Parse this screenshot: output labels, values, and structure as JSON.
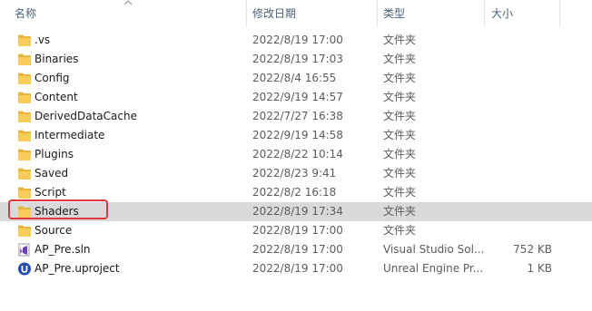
{
  "columns": {
    "name": "名称",
    "date": "修改日期",
    "type": "类型",
    "size": "大小"
  },
  "files": [
    {
      "icon": "folder-icon",
      "name": ".vs",
      "date": "2022/8/19 17:00",
      "type": "文件夹",
      "size": ""
    },
    {
      "icon": "folder-icon",
      "name": "Binaries",
      "date": "2022/8/19 17:03",
      "type": "文件夹",
      "size": ""
    },
    {
      "icon": "folder-icon",
      "name": "Config",
      "date": "2022/8/4 16:55",
      "type": "文件夹",
      "size": ""
    },
    {
      "icon": "folder-icon",
      "name": "Content",
      "date": "2022/9/19 14:57",
      "type": "文件夹",
      "size": ""
    },
    {
      "icon": "folder-icon",
      "name": "DerivedDataCache",
      "date": "2022/7/27 16:38",
      "type": "文件夹",
      "size": ""
    },
    {
      "icon": "folder-icon",
      "name": "Intermediate",
      "date": "2022/9/19 14:58",
      "type": "文件夹",
      "size": ""
    },
    {
      "icon": "folder-icon",
      "name": "Plugins",
      "date": "2022/8/22 10:14",
      "type": "文件夹",
      "size": ""
    },
    {
      "icon": "folder-icon",
      "name": "Saved",
      "date": "2022/8/23 9:41",
      "type": "文件夹",
      "size": ""
    },
    {
      "icon": "folder-icon",
      "name": "Script",
      "date": "2022/8/2 16:18",
      "type": "文件夹",
      "size": ""
    },
    {
      "icon": "folder-icon",
      "name": "Shaders",
      "date": "2022/8/19 17:34",
      "type": "文件夹",
      "size": ""
    },
    {
      "icon": "folder-icon",
      "name": "Source",
      "date": "2022/8/19 17:00",
      "type": "文件夹",
      "size": ""
    },
    {
      "icon": "visual-studio-solution-icon",
      "name": "AP_Pre.sln",
      "date": "2022/8/19 17:00",
      "type": "Visual Studio Sol...",
      "size": "752 KB"
    },
    {
      "icon": "unreal-engine-project-icon",
      "name": "AP_Pre.uproject",
      "date": "2022/8/19 17:00",
      "type": "Unreal Engine Pr...",
      "size": "1 KB"
    }
  ],
  "selected_file": "Shaders",
  "highlighted_file": "Shaders",
  "colors": {
    "header_text": "#4c607a",
    "selection_bg": "#d9d9d9",
    "highlight_border": "#e0363f",
    "folder": "#f8cc5a"
  }
}
